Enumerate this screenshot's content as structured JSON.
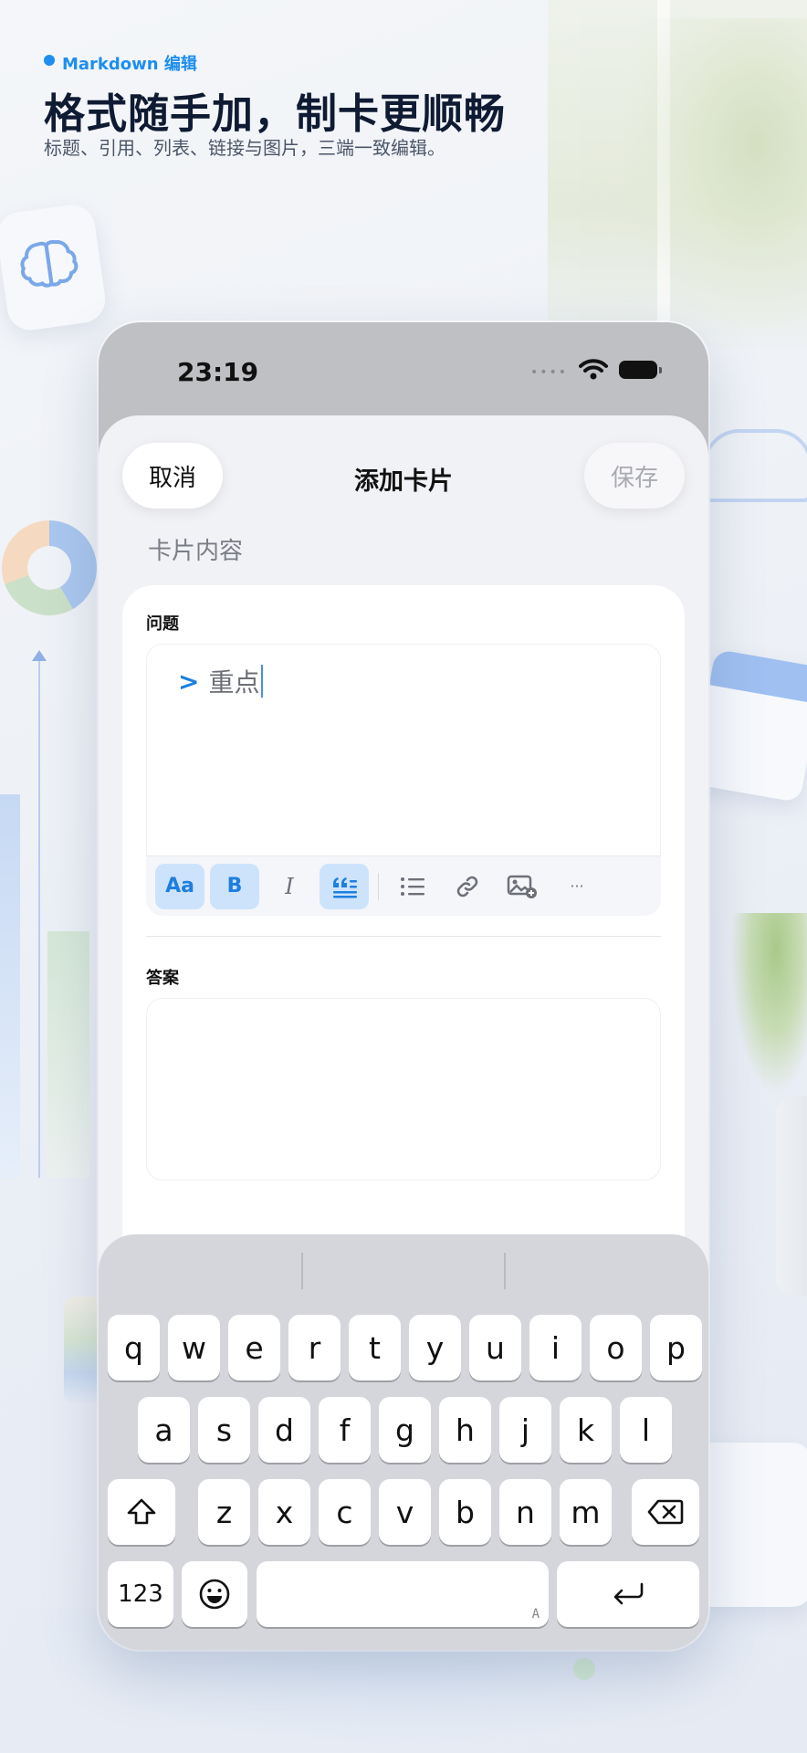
{
  "header": {
    "badge": "Markdown 编辑",
    "headline": "格式随手加，制卡更顺畅",
    "subline": "标题、引用、列表、链接与图片，三端一致编辑。"
  },
  "status_bar": {
    "time": "23:19",
    "icons": [
      "signal-dots-icon",
      "wifi-icon",
      "battery-icon"
    ]
  },
  "nav": {
    "cancel": "取消",
    "title": "添加卡片",
    "save": "保存"
  },
  "form": {
    "section_label": "卡片内容",
    "question_label": "问题",
    "question_quote_mark": ">",
    "question_text": "重点",
    "answer_label": "答案",
    "answer_text": ""
  },
  "toolbar": {
    "items": [
      {
        "name": "heading",
        "label": "Aa",
        "active": true
      },
      {
        "name": "bold",
        "label": "B",
        "active": true
      },
      {
        "name": "italic",
        "label": "I",
        "active": false
      },
      {
        "name": "quote",
        "label": "",
        "active": true
      },
      {
        "name": "list",
        "label": "",
        "active": false
      },
      {
        "name": "link",
        "label": "",
        "active": false
      },
      {
        "name": "image",
        "label": "",
        "active": false
      },
      {
        "name": "more",
        "label": "···",
        "active": false
      }
    ]
  },
  "keyboard": {
    "row1": [
      "q",
      "w",
      "e",
      "r",
      "t",
      "y",
      "u",
      "i",
      "o",
      "p"
    ],
    "row2": [
      "a",
      "s",
      "d",
      "f",
      "g",
      "h",
      "j",
      "k",
      "l"
    ],
    "row3": [
      "z",
      "x",
      "c",
      "v",
      "b",
      "n",
      "m"
    ],
    "numbers_key": "123",
    "space_hint": "A"
  },
  "colors": {
    "accent": "#1d7fe0",
    "headline": "#0f1b33",
    "active_button_bg": "#cde3fb"
  }
}
